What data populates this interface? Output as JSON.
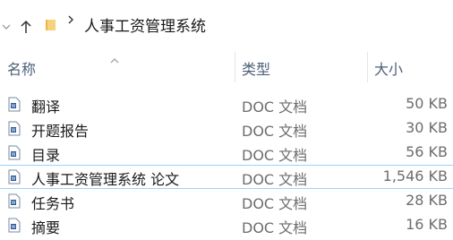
{
  "address_bar": {
    "path_label": "人事工资管理系统"
  },
  "columns": {
    "name": "名称",
    "type": "类型",
    "size": "大小"
  },
  "files": [
    {
      "name": "翻译",
      "type": "DOC 文档",
      "size": "50 KB"
    },
    {
      "name": "开题报告",
      "type": "DOC 文档",
      "size": "30 KB"
    },
    {
      "name": "目录",
      "type": "DOC 文档",
      "size": "56 KB"
    },
    {
      "name": "人事工资管理系统 论文",
      "type": "DOC 文档",
      "size": "1,546 KB"
    },
    {
      "name": "任务书",
      "type": "DOC 文档",
      "size": "28 KB"
    },
    {
      "name": "摘要",
      "type": "DOC 文档",
      "size": "16 KB"
    }
  ],
  "icons": {
    "folder": "folder-icon",
    "file": "word-doc-icon",
    "nav_up": "arrow-up-icon",
    "nav_recent": "chevron-down-icon",
    "breadcrumb": "chevron-right-icon",
    "sort": "sort-ascending-icon"
  },
  "colors": {
    "header_text": "#4c607a",
    "row_highlight_border": "#99d1ff",
    "folder_yellow": "#f2c55c"
  }
}
